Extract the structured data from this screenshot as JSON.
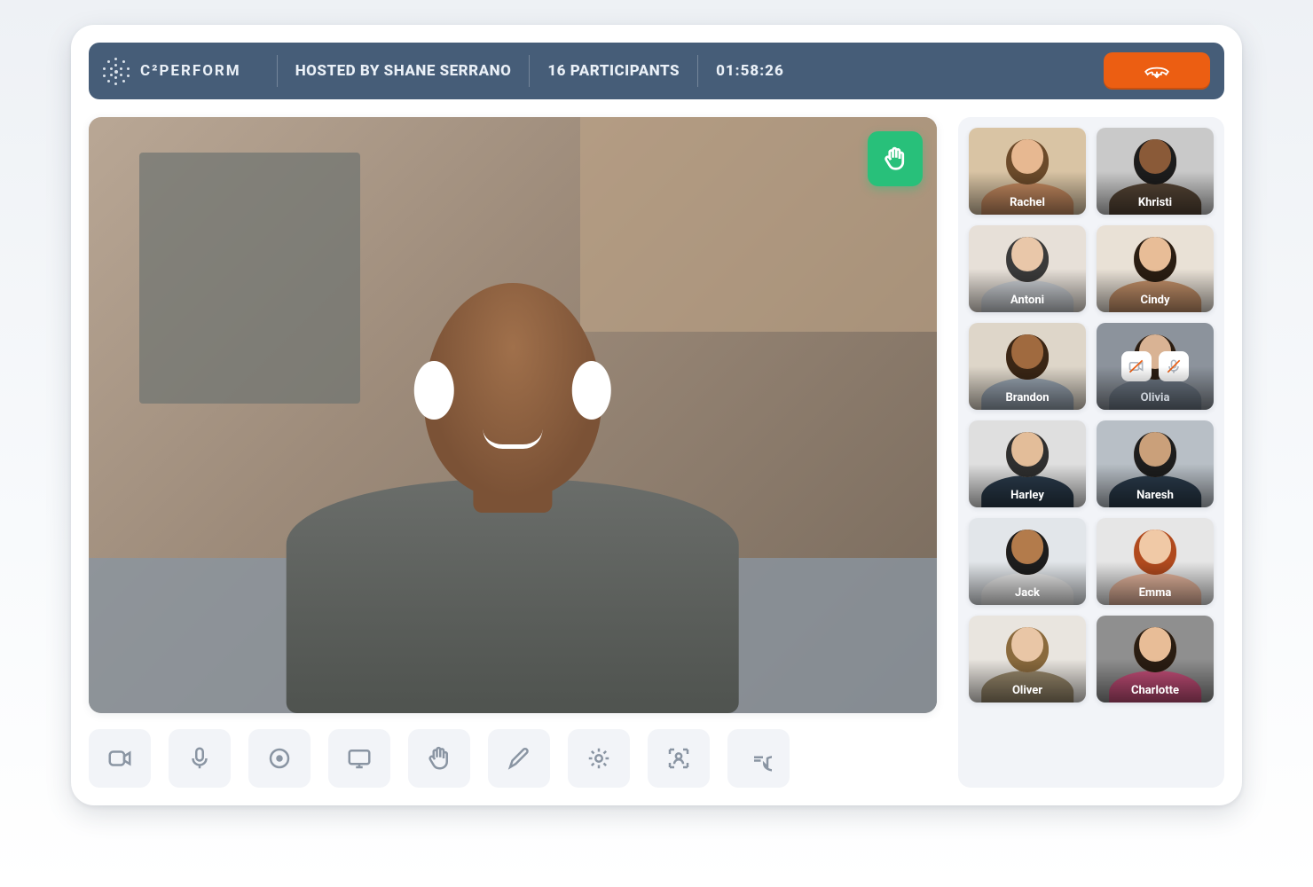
{
  "brand": {
    "name": "C²PERFORM"
  },
  "header": {
    "hosted_by_label": "HOSTED BY SHANE SERRANO",
    "participants_label": "16 PARTICIPANTS",
    "timer": "01:58:26"
  },
  "colors": {
    "header_bg": "#465d78",
    "end_call": "#ec5e12",
    "raise_hand": "#28c07a",
    "toolbar_icon": "#8a95a3",
    "panel_bg": "#f2f4f8"
  },
  "main_speaker": {
    "hand_raised": true
  },
  "toolbar": {
    "items": [
      {
        "id": "camera",
        "label": "Camera"
      },
      {
        "id": "mic",
        "label": "Microphone"
      },
      {
        "id": "record",
        "label": "Record"
      },
      {
        "id": "screen",
        "label": "Share Screen"
      },
      {
        "id": "raise-hand",
        "label": "Raise Hand"
      },
      {
        "id": "annotate",
        "label": "Annotate"
      },
      {
        "id": "settings",
        "label": "Settings"
      },
      {
        "id": "layout",
        "label": "Change Layout"
      },
      {
        "id": "chat",
        "label": "Chat"
      }
    ]
  },
  "participants": [
    {
      "name": "Rachel",
      "bg": "#d9c4a4",
      "skin": "#e7b891",
      "hair": "#6b4a2a",
      "body": "#c98d62",
      "muted": false
    },
    {
      "name": "Khristi",
      "bg": "#c9c9c9",
      "skin": "#8a5a38",
      "hair": "#1c1c1c",
      "body": "#574636",
      "muted": false
    },
    {
      "name": "Antoni",
      "bg": "#e7e0d8",
      "skin": "#e9c7a9",
      "hair": "#3a3a3a",
      "body": "#cfd3d8",
      "muted": false
    },
    {
      "name": "Cindy",
      "bg": "#e9e1d6",
      "skin": "#e8bd97",
      "hair": "#2a1d12",
      "body": "#c8946c",
      "muted": false
    },
    {
      "name": "Brandon",
      "bg": "#ded6c9",
      "skin": "#a06a3f",
      "hair": "#3a2615",
      "body": "#9aa6b2",
      "muted": false
    },
    {
      "name": "Olivia",
      "bg": "#9aa4b0",
      "skin": "#d9b394",
      "hair": "#2a1d12",
      "body": "#6d7885",
      "muted": true
    },
    {
      "name": "Harley",
      "bg": "#dfdfdf",
      "skin": "#e3bd99",
      "hair": "#2f2f2f",
      "body": "#2b3c4d",
      "muted": false
    },
    {
      "name": "Naresh",
      "bg": "#b8bfc6",
      "skin": "#caa07a",
      "hair": "#1d1d1d",
      "body": "#2b3c4d",
      "muted": false
    },
    {
      "name": "Jack",
      "bg": "#e2e6ea",
      "skin": "#b37b4b",
      "hair": "#1d1d1d",
      "body": "#efefef",
      "muted": false
    },
    {
      "name": "Emma",
      "bg": "#e6e6e6",
      "skin": "#f0c9a6",
      "hair": "#b04a1e",
      "body": "#e9b8a0",
      "muted": false
    },
    {
      "name": "Oliver",
      "bg": "#e9e5df",
      "skin": "#e9c6a6",
      "hair": "#8a6a3d",
      "body": "#9a8a6d",
      "muted": false
    },
    {
      "name": "Charlotte",
      "bg": "#8f8f8f",
      "skin": "#e8bd97",
      "hair": "#2a1d12",
      "body": "#c64f7a",
      "muted": false
    }
  ]
}
